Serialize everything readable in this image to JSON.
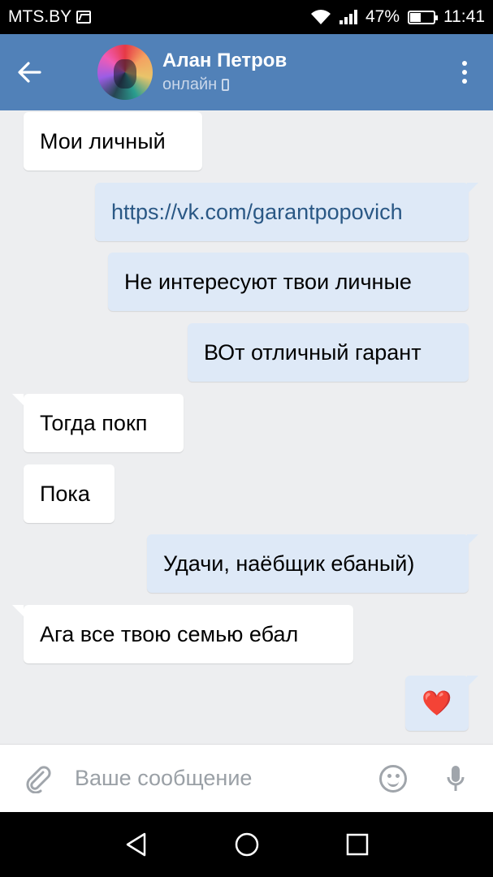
{
  "status_bar": {
    "carrier": "MTS.BY",
    "battery": "47%",
    "time": "11:41"
  },
  "header": {
    "title": "Алан Петров",
    "subtitle": "онлайн"
  },
  "messages": [
    {
      "side": "in",
      "text": "Мои личный"
    },
    {
      "side": "out",
      "text": "https://vk.com/garantpopovich",
      "is_link": true
    },
    {
      "side": "out",
      "text": "Не интересуют твои личные"
    },
    {
      "side": "out",
      "text": "ВОт отличный гарант"
    },
    {
      "side": "in",
      "text": "Тогда покп"
    },
    {
      "side": "in",
      "text": "Пока"
    },
    {
      "side": "out",
      "text": "Удачи, наёбщик ебаный)"
    },
    {
      "side": "in",
      "text": "Ага все твою семью ебал"
    },
    {
      "side": "out",
      "text": "❤️"
    }
  ],
  "composer": {
    "placeholder": "Ваше сообщение"
  },
  "colors": {
    "header": "#5181b8",
    "outgoing_bubble": "#dee9f7",
    "incoming_bubble": "#ffffff",
    "chat_background": "#edeef0"
  }
}
